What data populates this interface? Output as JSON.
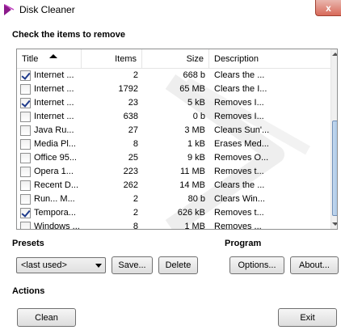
{
  "window": {
    "title": "Disk Cleaner",
    "close_label": "x"
  },
  "check_section": {
    "label": "Check the items to remove"
  },
  "table": {
    "columns": {
      "title": "Title",
      "items": "Items",
      "size": "Size",
      "description": "Description"
    },
    "sorted_by": "Title",
    "sort_direction": "ascending",
    "rows": [
      {
        "title": "Internet ...",
        "items": "2",
        "size": "668 b",
        "description": "Clears the ...",
        "checked": true
      },
      {
        "title": "Internet ...",
        "items": "1792",
        "size": "65 MB",
        "description": "Clears the I...",
        "checked": false
      },
      {
        "title": "Internet ...",
        "items": "23",
        "size": "5 kB",
        "description": "Removes I...",
        "checked": true
      },
      {
        "title": "Internet ...",
        "items": "638",
        "size": "0 b",
        "description": "Removes I...",
        "checked": false
      },
      {
        "title": "Java Ru...",
        "items": "27",
        "size": "3 MB",
        "description": "Cleans Sun'...",
        "checked": false
      },
      {
        "title": "Media Pl...",
        "items": "8",
        "size": "1 kB",
        "description": "Erases Med...",
        "checked": false
      },
      {
        "title": "Office 95...",
        "items": "25",
        "size": "9 kB",
        "description": "Removes O...",
        "checked": false
      },
      {
        "title": "Opera 1...",
        "items": "223",
        "size": "11 MB",
        "description": "Removes t...",
        "checked": false
      },
      {
        "title": "Recent D...",
        "items": "262",
        "size": "14 MB",
        "description": "Clears the ...",
        "checked": false
      },
      {
        "title": "Run... M...",
        "items": "2",
        "size": "80 b",
        "description": "Clears Win...",
        "checked": false
      },
      {
        "title": "Tempora...",
        "items": "2",
        "size": "626 kB",
        "description": "Removes t...",
        "checked": true
      },
      {
        "title": "Windows ...",
        "items": "8",
        "size": "1 MB",
        "description": "Removes ...",
        "checked": false
      }
    ]
  },
  "presets": {
    "label": "Presets",
    "selected": "<last used>",
    "save_label": "Save...",
    "delete_label": "Delete"
  },
  "program": {
    "label": "Program",
    "options_label": "Options...",
    "about_label": "About..."
  },
  "actions": {
    "label": "Actions",
    "clean_label": "Clean",
    "exit_label": "Exit"
  },
  "colors": {
    "accent": "#800080",
    "close_button": "#d86a5a",
    "scroll_thumb": "#a9c6e6"
  },
  "icons": {
    "app": "disk-cleaner-icon",
    "sort": "sort-ascending-icon"
  }
}
